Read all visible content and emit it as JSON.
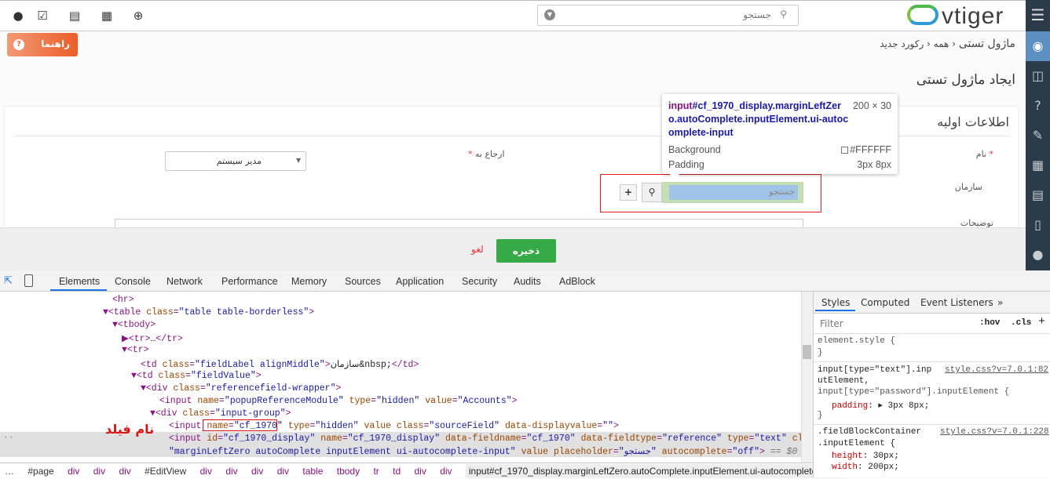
{
  "topbar": {
    "icons": [
      "user-icon",
      "tasks-icon",
      "reports-icon",
      "calendar-icon",
      "add-icon"
    ],
    "search_placeholder": "جستجو",
    "logo": "vtiger"
  },
  "rail": {
    "icons": [
      "menu-icon",
      "support-icon",
      "tickets-icon",
      "faq-icon",
      "edit-icon",
      "organizations-icon",
      "documents-icon",
      "products-icon",
      "contacts-icon"
    ]
  },
  "help_button": "راهنما",
  "breadcrumb": [
    "ماژول تستی",
    "همه",
    "رکورد جدید"
  ],
  "page_title": "ایجاد ماژول تستی",
  "section_title": "اطلاعات اولیه",
  "fields": {
    "name_label": "نام",
    "assigned_label": "ارجاع به",
    "assigned_value": "مدیر سیستم",
    "org_label": "سازمان",
    "org_placeholder": "جستجو",
    "desc_label": "توضیحات",
    "required": "*"
  },
  "footer": {
    "save": "ذخیره",
    "cancel": "لغو"
  },
  "tooltip": {
    "tag": "input",
    "selector": "#cf_1970_display.marginLeftZero.autoComplete.inputElement.ui-autocomplete-input",
    "size": "200 × 30",
    "bg_label": "Background",
    "bg_value": "#FFFFFF",
    "pad_label": "Padding",
    "pad_value": "3px 8px"
  },
  "devtools": {
    "tabs": [
      "Elements",
      "Console",
      "Network",
      "Performance",
      "Memory",
      "Sources",
      "Application",
      "Security",
      "Audits",
      "AdBlock"
    ],
    "annotation": "نام فیلد",
    "breadcrumb": [
      "#page",
      "div",
      "div",
      "div",
      "#EditView",
      "div",
      "div",
      "div",
      "div",
      "table",
      "tbody",
      "tr",
      "td",
      "div",
      "div"
    ],
    "breadcrumb_selected": "input#cf_1970_display.marginLeftZero.autoComplete.inputElement.ui-autocomplete-input",
    "styles": {
      "tabs": [
        "Styles",
        "Computed",
        "Event Listeners",
        "»"
      ],
      "filter_placeholder": "Filter",
      "hov": ":hov",
      "cls": ".cls",
      "plus": "+",
      "rule0": "element.style {",
      "close": "}",
      "rule1_sel1": "input[type=\"text\"].inp",
      "rule1_sel2": "utElement,",
      "rule1_sel3": "input[type=\"password\"].inputElement {",
      "rule1_src": "style.css?v=7.0.1:82",
      "rule1_prop": "padding",
      "rule1_val": ": ▸ 3px 8px;",
      "rule2_sel1": ".fieldBlockContainer",
      "rule2_sel2": ".inputElement {",
      "rule2_src": "style.css?v=7.0.1:228",
      "rule2_p1": "height",
      "rule2_v1": ": 30px;",
      "rule2_p2": "width",
      "rule2_v2": ": 200px;"
    }
  }
}
